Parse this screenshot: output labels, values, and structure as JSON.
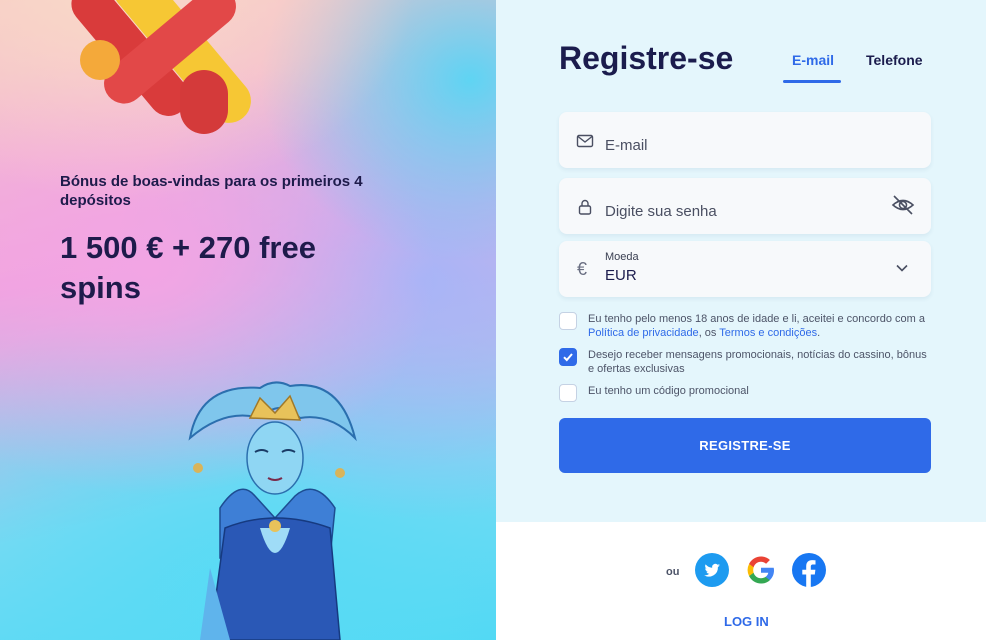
{
  "promo": {
    "subtitle": "Bónus de boas-vindas para os primeiros 4 depósitos",
    "amount": "1 500 € + 270 free spins"
  },
  "form": {
    "title": "Registre-se",
    "tabs": [
      {
        "label": "E-mail",
        "active": true
      },
      {
        "label": "Telefone",
        "active": false
      }
    ],
    "email_placeholder": "E-mail",
    "password_placeholder": "Digite sua senha",
    "currency": {
      "label": "Moeda",
      "value": "EUR",
      "symbol": "€"
    },
    "checks": [
      {
        "checked": false,
        "text_before": "Eu tenho pelo menos 18 anos de idade e li, aceitei e concordo com a ",
        "link1": "Política de privacidade",
        "text_mid": ", os ",
        "link2": "Termos e condições",
        "text_after": "."
      },
      {
        "checked": true,
        "text": "Desejo receber mensagens promocionais, notícias do cassino, bônus e ofertas exclusivas"
      },
      {
        "checked": false,
        "text": "Eu tenho um código promocional"
      }
    ],
    "submit_label": "REGISTRE-SE"
  },
  "social": {
    "or_label": "ou",
    "providers": [
      "twitter-icon",
      "google-icon",
      "facebook-icon"
    ],
    "login_label": "LOG IN"
  },
  "colors": {
    "accent": "#2f6ae8",
    "heading": "#1b1c4d",
    "form_bg": "#e4f6fc",
    "twitter": "#1d9bf0",
    "facebook": "#1877f2"
  }
}
